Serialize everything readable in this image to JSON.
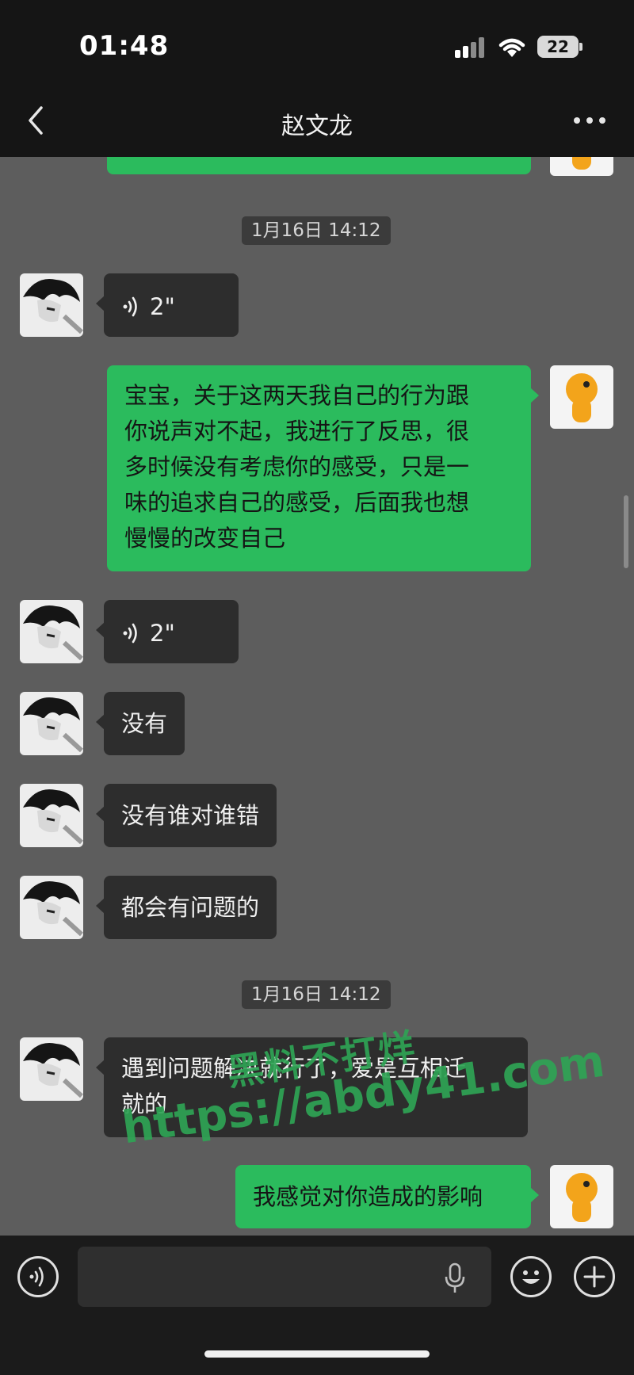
{
  "status_bar": {
    "time": "01:48",
    "battery": "22"
  },
  "header": {
    "title": "赵文龙"
  },
  "messages": [
    {
      "side": "sent",
      "text": ""
    },
    {
      "kind": "timestamp",
      "text": "1月16日 14:12"
    },
    {
      "side": "received",
      "kind": "voice",
      "duration": "2\""
    },
    {
      "side": "sent",
      "text": "宝宝，关于这两天我自己的行为跟\n你说声对不起，我进行了反思，很\n多时候没有考虑你的感受，只是一\n味的追求自己的感受，后面我也想\n慢慢的改变自己"
    },
    {
      "side": "received",
      "kind": "voice",
      "duration": "2\""
    },
    {
      "side": "received",
      "text": "没有"
    },
    {
      "side": "received",
      "text": "没有谁对谁错"
    },
    {
      "side": "received",
      "text": "都会有问题的"
    },
    {
      "kind": "timestamp",
      "text": "1月16日 14:12"
    },
    {
      "side": "received",
      "text": "遇到问题解决就行了，爱是互相迁\n就的"
    },
    {
      "side": "sent",
      "text": "我感觉对你造成的影响"
    }
  ],
  "watermark": {
    "line1": "黑料不打烊",
    "line2": "https://abdy41.com"
  },
  "input_bar": {
    "text": ""
  },
  "colors": {
    "sent_bubble": "#2bbb5d",
    "received_bubble": "#2d2d2d",
    "chat_bg": "#5d5d5d",
    "bar_bg": "#151515"
  },
  "icons": [
    "back-icon",
    "more-icon",
    "voice-toggle-icon",
    "microphone-icon",
    "emoji-icon",
    "plus-icon",
    "voice-wave-icon"
  ]
}
